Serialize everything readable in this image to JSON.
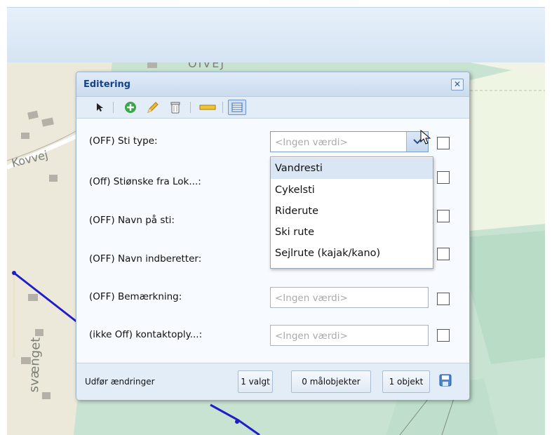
{
  "map": {
    "labels": [
      "Kovvej",
      "svænget",
      "OIVEJ"
    ]
  },
  "dialog": {
    "title": "Editering",
    "close_symbol": "✕",
    "toolbar": {
      "icons": [
        "pointer-icon",
        "add-feature-icon",
        "edit-pencil-icon",
        "delete-bin-icon",
        "measure-ruler-icon",
        "attribute-table-icon"
      ]
    },
    "fields": [
      {
        "label": "(OFF) Sti type:",
        "value": "<Ingen værdi>",
        "type": "dropdown"
      },
      {
        "label": "(Off) Stiønske fra Lok...:",
        "value": "",
        "type": "text"
      },
      {
        "label": "(OFF) Navn på sti:",
        "value": "",
        "type": "text"
      },
      {
        "label": "(OFF) Navn indberetter:",
        "value": "",
        "type": "text"
      },
      {
        "label": "(OFF) Bemærkning:",
        "value": "<Ingen værdi>",
        "type": "text"
      },
      {
        "label": "(ikke Off) kontaktoply...:",
        "value": "<Ingen værdi>",
        "type": "text"
      }
    ],
    "dropdown_options": [
      "Vandresti",
      "Cykelsti",
      "Riderute",
      "Ski rute",
      "Sejlrute (kajak/kano)"
    ],
    "footer": {
      "apply_label": "Udfør ændringer",
      "selected_button": "1 valgt",
      "targets_button": "0 målobjekter",
      "object_button": "1 objekt"
    }
  },
  "colors": {
    "title": "#15428b",
    "map_green": "#c4e1cf",
    "map_beige": "#f1efe0",
    "line_blue": "#1f1fc8"
  }
}
